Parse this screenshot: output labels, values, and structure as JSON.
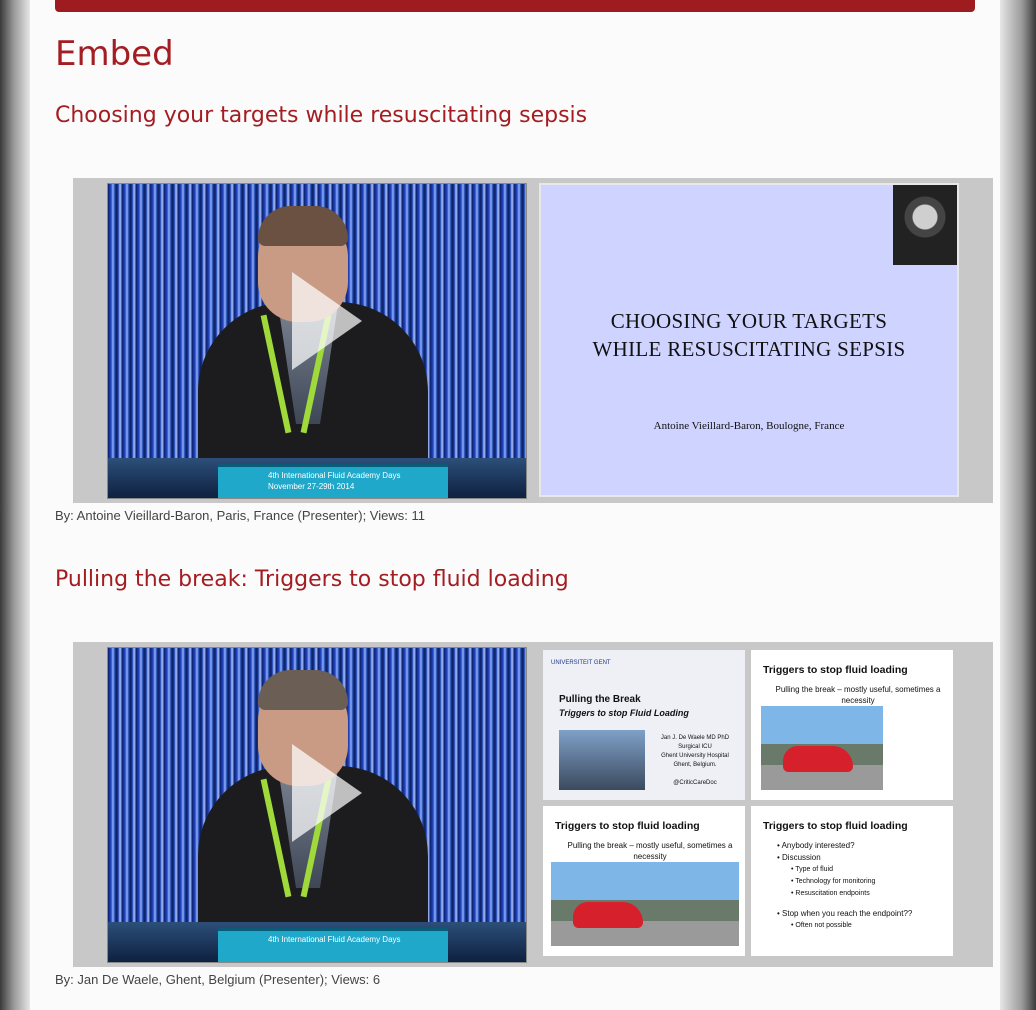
{
  "page": {
    "title": "Embed"
  },
  "items": [
    {
      "title": "Choosing your targets while resuscitating sepsis",
      "podium_text": "4th International Fluid Academy Days\nNovember 27-29th 2014",
      "slide_title": "CHOOSING YOUR TARGETS\nWHILE RESUSCITATING SEPSIS",
      "slide_author": "Antoine Vieillard-Baron, Boulogne, France",
      "byline": "By: Antoine Vieillard-Baron, Paris, France (Presenter); Views: 11"
    },
    {
      "title": "Pulling the break: Triggers to stop fluid loading",
      "podium_text": "4th International Fluid Academy Days",
      "thumbs": {
        "t1": {
          "logo": "UNIVERSITEIT GENT",
          "title": "Pulling the Break",
          "subtitle": "Triggers to stop Fluid Loading",
          "info": "Jan J. De Waele MD PhD\nSurgical ICU\nGhent University Hospital\nGhent, Belgium.\n\n@CriticCareDoc"
        },
        "t2": {
          "title": "Triggers to stop fluid loading",
          "sub": "Pulling the break – mostly useful, sometimes a necessity"
        },
        "t3": {
          "title": "Triggers to stop fluid loading",
          "sub": "Pulling the break – mostly useful, sometimes a necessity"
        },
        "t4": {
          "title": "Triggers to stop fluid loading",
          "b1": "• Anybody interested?",
          "b2": "• Discussion",
          "b3": "• Type of fluid",
          "b4": "• Technology for monitoring",
          "b5": "• Resuscitation endpoints",
          "b6": "• Stop when you reach the endpoint??",
          "b7": "• Often not possible"
        }
      },
      "byline": "By: Jan De Waele, Ghent, Belgium (Presenter); Views: 6"
    }
  ],
  "colors": {
    "accent": "#a31d22",
    "topbar": "#9e1b1f"
  },
  "icons": {
    "play": "play-icon"
  }
}
